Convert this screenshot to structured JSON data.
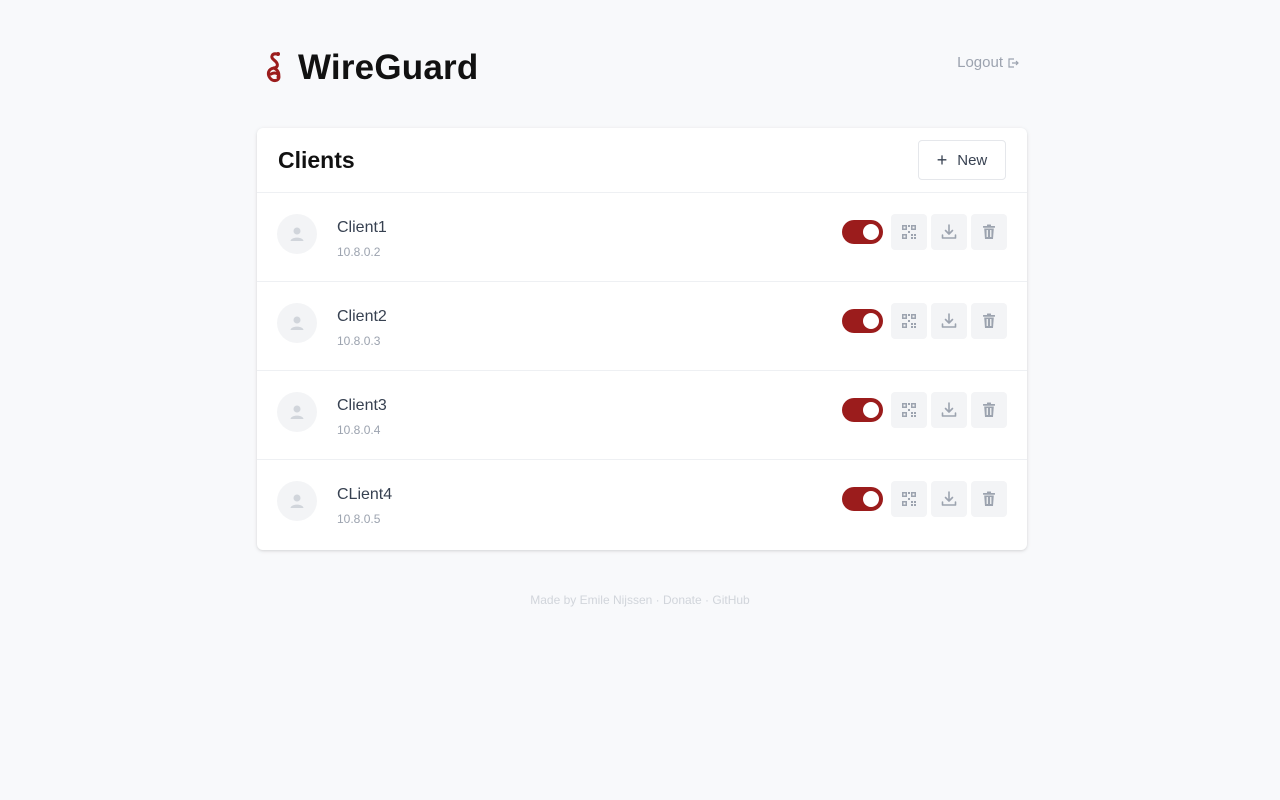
{
  "header": {
    "title": "WireGuard",
    "logout_label": "Logout",
    "brand_color": "#9b1c1c"
  },
  "clients_card": {
    "title": "Clients",
    "new_label": "New",
    "clients": [
      {
        "name": "Client1",
        "ip": "10.8.0.2",
        "enabled": true
      },
      {
        "name": "Client2",
        "ip": "10.8.0.3",
        "enabled": true
      },
      {
        "name": "Client3",
        "ip": "10.8.0.4",
        "enabled": true
      },
      {
        "name": "CLient4",
        "ip": "10.8.0.5",
        "enabled": true
      }
    ],
    "row_icons": [
      "qrcode-icon",
      "download-icon",
      "trash-icon"
    ]
  },
  "footer": {
    "made_by": "Made by Emile Nijssen",
    "sep": "·",
    "donate": "Donate",
    "github": "GitHub"
  }
}
